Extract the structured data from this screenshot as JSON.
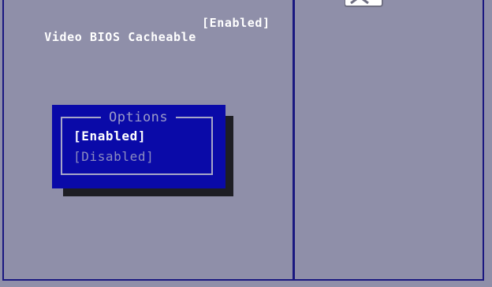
{
  "setting": {
    "name": "Video BIOS Cacheable",
    "value": "[Enabled]"
  },
  "options_popup": {
    "title": "Options",
    "items": [
      {
        "label": "[Enabled]",
        "selected": true
      },
      {
        "label": "[Disabled]",
        "selected": false
      }
    ]
  },
  "colors": {
    "background": "#8f8fa9",
    "popup": "#0a0aa8",
    "border": "#1a1880"
  }
}
